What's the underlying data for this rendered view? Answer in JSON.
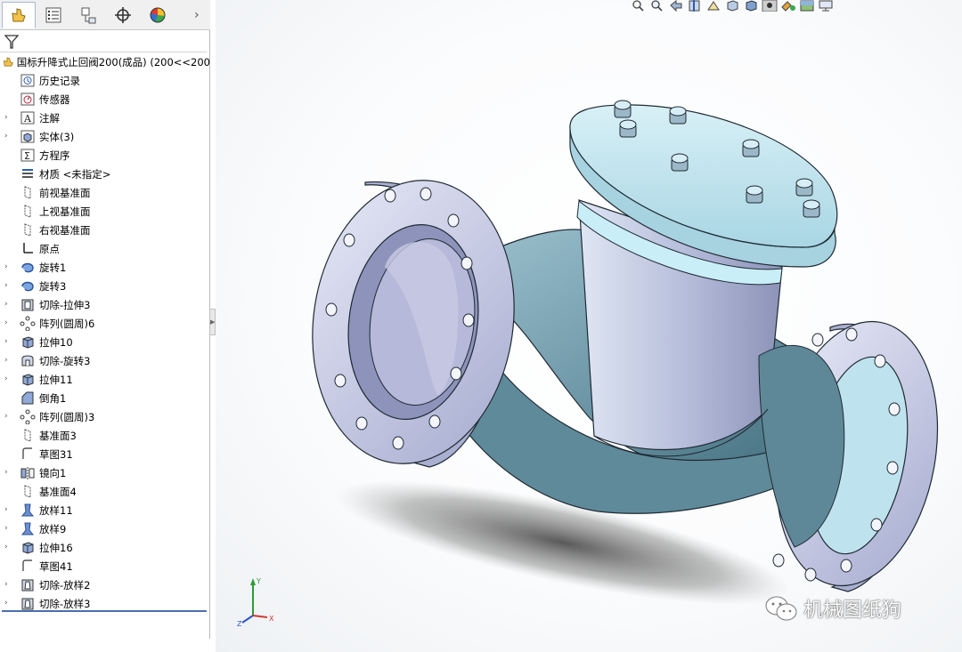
{
  "feature_tree": {
    "root_label": "国标升降式止回阀200(成品)  (200<<200",
    "items": [
      {
        "label": "历史记录",
        "icon": "history-icon",
        "expandable": false
      },
      {
        "label": "传感器",
        "icon": "sensor-icon",
        "expandable": false
      },
      {
        "label": "注解",
        "icon": "annotation-icon",
        "expandable": true
      },
      {
        "label": "实体(3)",
        "icon": "solid-bodies-icon",
        "expandable": true
      },
      {
        "label": "方程序",
        "icon": "equations-icon",
        "expandable": false
      },
      {
        "label": "材质 <未指定>",
        "icon": "material-icon",
        "expandable": false
      },
      {
        "label": "前视基准面",
        "icon": "plane-icon",
        "expandable": false
      },
      {
        "label": "上视基准面",
        "icon": "plane-icon",
        "expandable": false
      },
      {
        "label": "右视基准面",
        "icon": "plane-icon",
        "expandable": false
      },
      {
        "label": "原点",
        "icon": "origin-icon",
        "expandable": false
      },
      {
        "label": "旋转1",
        "icon": "revolve-icon",
        "expandable": true
      },
      {
        "label": "旋转3",
        "icon": "revolve-icon",
        "expandable": true
      },
      {
        "label": "切除-拉伸3",
        "icon": "cut-extrude-icon",
        "expandable": true
      },
      {
        "label": "阵列(圆周)6",
        "icon": "circular-pattern-icon",
        "expandable": true
      },
      {
        "label": "拉伸10",
        "icon": "extrude-icon",
        "expandable": true
      },
      {
        "label": "切除-旋转3",
        "icon": "cut-revolve-icon",
        "expandable": true
      },
      {
        "label": "拉伸11",
        "icon": "extrude-icon",
        "expandable": true
      },
      {
        "label": "倒角1",
        "icon": "chamfer-icon",
        "expandable": false
      },
      {
        "label": "阵列(圆周)3",
        "icon": "circular-pattern-icon",
        "expandable": true
      },
      {
        "label": "基准面3",
        "icon": "plane-icon",
        "expandable": false
      },
      {
        "label": "草图31",
        "icon": "sketch-icon",
        "expandable": false
      },
      {
        "label": "镜向1",
        "icon": "mirror-icon",
        "expandable": true
      },
      {
        "label": "基准面4",
        "icon": "plane-icon",
        "expandable": false
      },
      {
        "label": "放样11",
        "icon": "loft-icon",
        "expandable": true
      },
      {
        "label": "放样9",
        "icon": "loft-icon",
        "expandable": true
      },
      {
        "label": "拉伸16",
        "icon": "extrude-icon",
        "expandable": true
      },
      {
        "label": "草图41",
        "icon": "sketch-icon",
        "expandable": false
      },
      {
        "label": "切除-放样2",
        "icon": "cut-loft-icon",
        "expandable": true
      },
      {
        "label": "切除-放样3",
        "icon": "cut-loft-icon",
        "expandable": true
      }
    ]
  },
  "panel_tabs": [
    "feature-manager-tab",
    "property-manager-tab",
    "configuration-manager-tab",
    "dimxpert-tab",
    "display-manager-tab"
  ],
  "triad": {
    "x": "X",
    "y": "Y",
    "z": "Z"
  },
  "watermark": {
    "text": "机械图纸狗"
  },
  "colors": {
    "accent": "#4a6fae",
    "body": "#8fb6c4",
    "flange_face": "#c9cde6",
    "bonnet": "#bfe3ee"
  }
}
